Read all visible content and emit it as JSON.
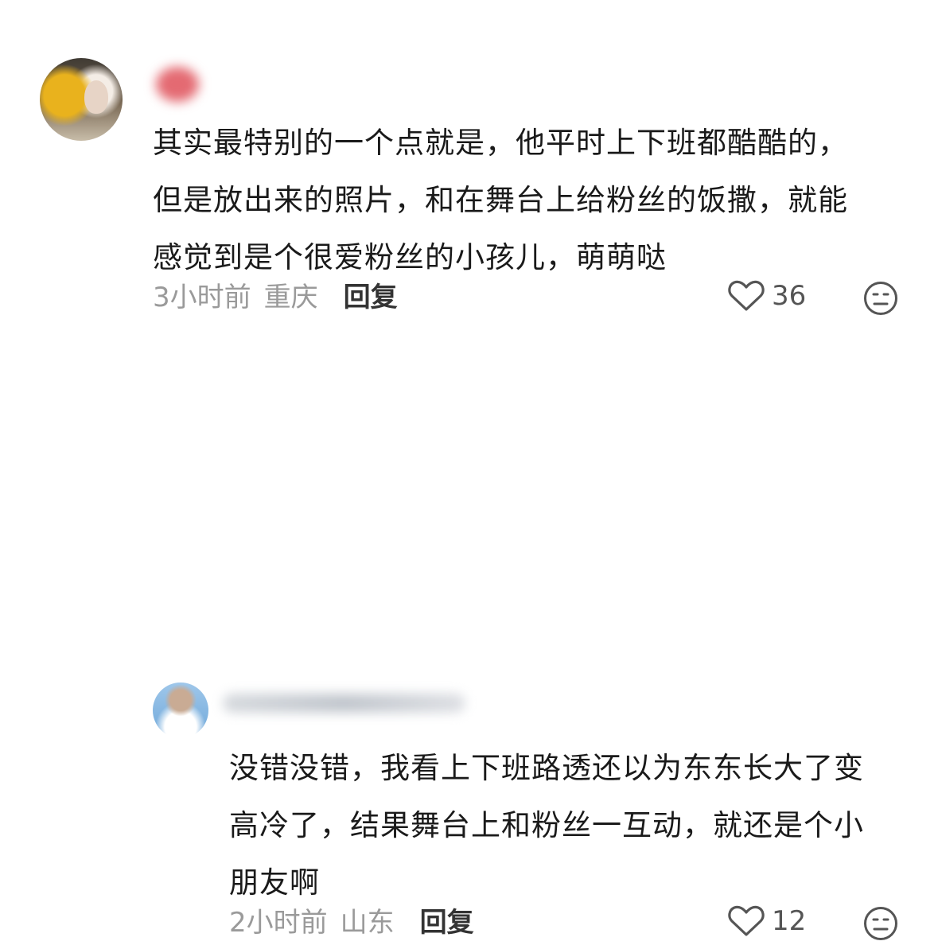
{
  "comments": [
    {
      "text": "其实最特别的一个点就是，他平时上下班都酷酷的，但是放出来的照片，和在舞台上给粉丝的饭撒，就能感觉到是个很爱粉丝的小孩儿，萌萌哒",
      "time": "3小时前",
      "location": "重庆",
      "reply_label": "回复",
      "likes": "36",
      "icons": {
        "avatar": "user-avatar",
        "like": "heart-icon",
        "dislike": "meh-face-icon"
      }
    },
    {
      "text": "没错没错，我看上下班路透还以为东东长大了变高冷了，结果舞台上和粉丝一互动，就还是个小朋友啊",
      "time": "2小时前",
      "location": "山东",
      "reply_label": "回复",
      "likes": "12",
      "icons": {
        "avatar": "user-avatar",
        "like": "heart-icon",
        "dislike": "meh-face-icon"
      }
    }
  ]
}
